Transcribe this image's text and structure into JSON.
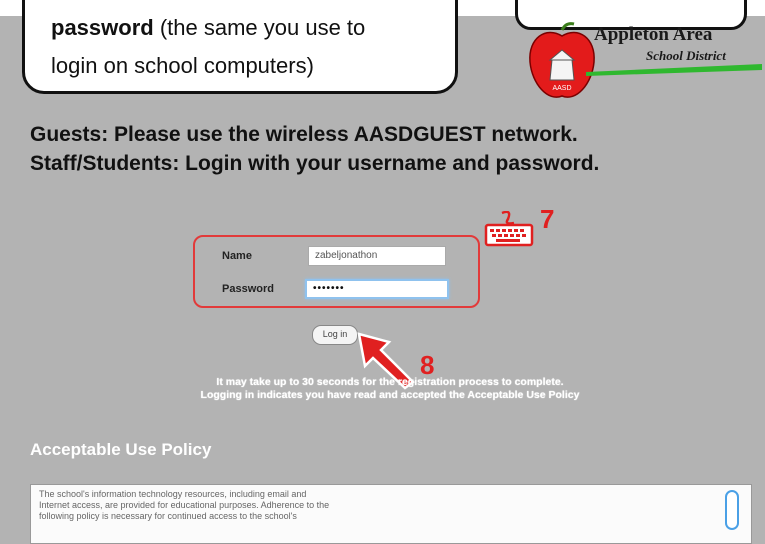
{
  "callout": {
    "bold": "password",
    "rest": " (the same you use to",
    "line2": "login on school computers)"
  },
  "logo": {
    "line1": "Appleton Area",
    "line2": "School District",
    "apple_label": "AASD",
    "colors": {
      "apple": "#e31b1b",
      "swoosh": "#2fb82f"
    }
  },
  "headline": {
    "line1": "Guests: Please use the wireless AASDGUEST network.",
    "line2": "Staff/Students: Login with your username and password."
  },
  "form": {
    "name_label": "Name",
    "name_value": "zabeljonathon",
    "password_label": "Password",
    "password_value": "•••••••",
    "login_label": "Log in"
  },
  "annotations": {
    "step7": "7",
    "step8": "8",
    "accent": "#e02020",
    "icons": [
      "keyboard-icon",
      "arrow-icon"
    ]
  },
  "notice": {
    "line1": "It may take up to 30 seconds for the registration process to complete.",
    "line2": "Logging in indicates you have read and accepted the Acceptable Use Policy"
  },
  "aup": {
    "title": "Acceptable Use Policy",
    "line1": "The school's information technology resources, including email and",
    "line2": "Internet access, are provided for educational purposes. Adherence to the",
    "line3": "following policy is necessary for continued access to the school's"
  }
}
